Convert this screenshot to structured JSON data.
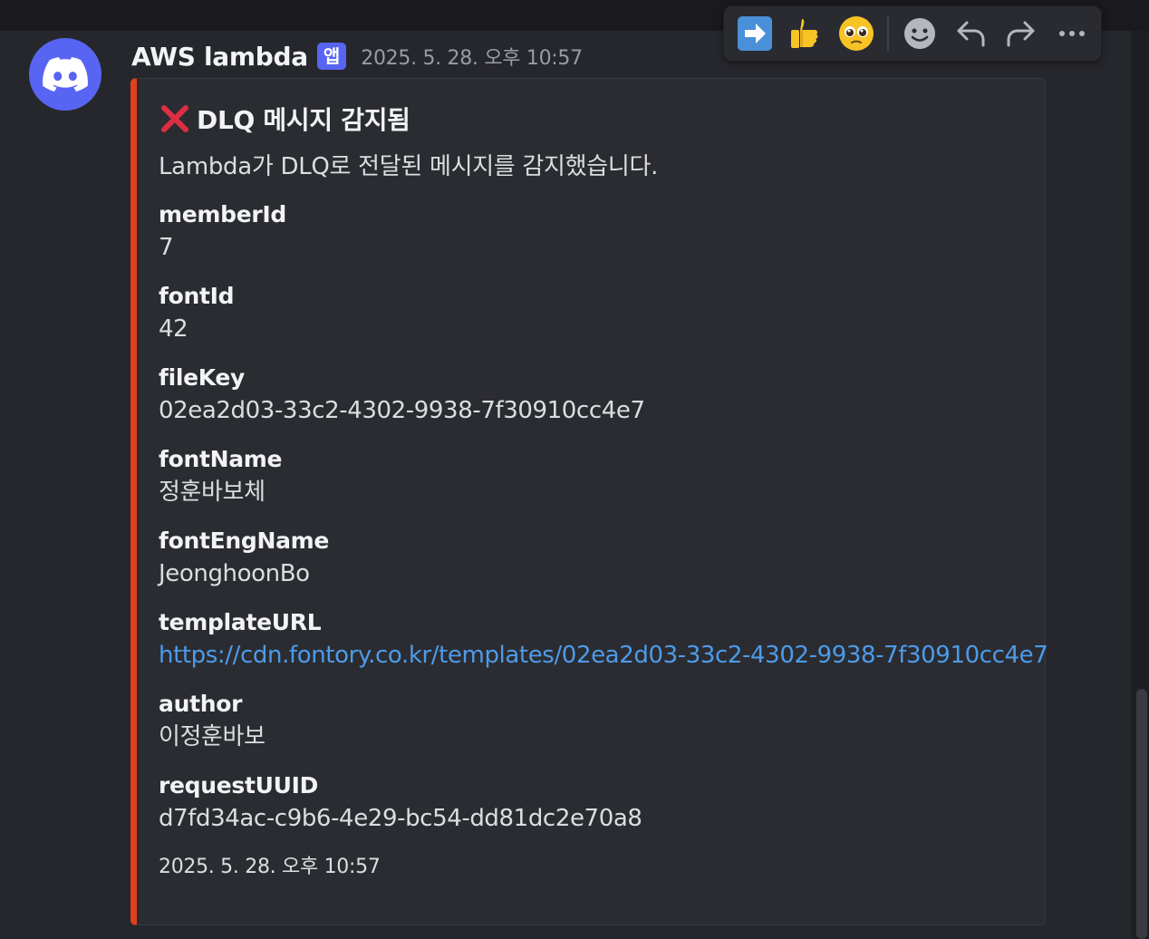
{
  "message": {
    "author": "AWS lambda",
    "badge": "앱",
    "timestamp": "2025. 5. 28. 오후 10:57"
  },
  "embed": {
    "accent_color": "#e0401f",
    "title_icon": "cross-mark-icon",
    "title": "DLQ 메시지 감지됨",
    "description": "Lambda가 DLQ로 전달된 메시지를 감지했습니다.",
    "fields": [
      {
        "name": "memberId",
        "value": "7"
      },
      {
        "name": "fontId",
        "value": "42"
      },
      {
        "name": "fileKey",
        "value": "02ea2d03-33c2-4302-9938-7f30910cc4e7"
      },
      {
        "name": "fontName",
        "value": "정훈바보체"
      },
      {
        "name": "fontEngName",
        "value": "JeonghoonBo"
      },
      {
        "name": "templateURL",
        "value": "https://cdn.fontory.co.kr/templates/02ea2d03-33c2-4302-9938-7f30910cc4e7"
      },
      {
        "name": "author",
        "value": "이정훈바보"
      },
      {
        "name": "requestUUID",
        "value": "d7fd34ac-c9b6-4e29-bc54-dd81dc2e70a8"
      }
    ],
    "footer_timestamp": "2025. 5. 28. 오후 10:57"
  },
  "toolbar": {
    "reactions": [
      "arrow-right-emoji",
      "thumbs-up-emoji",
      "pleading-face-emoji"
    ],
    "actions": [
      "add-reaction-icon",
      "reply-icon",
      "forward-icon",
      "more-icon"
    ]
  }
}
